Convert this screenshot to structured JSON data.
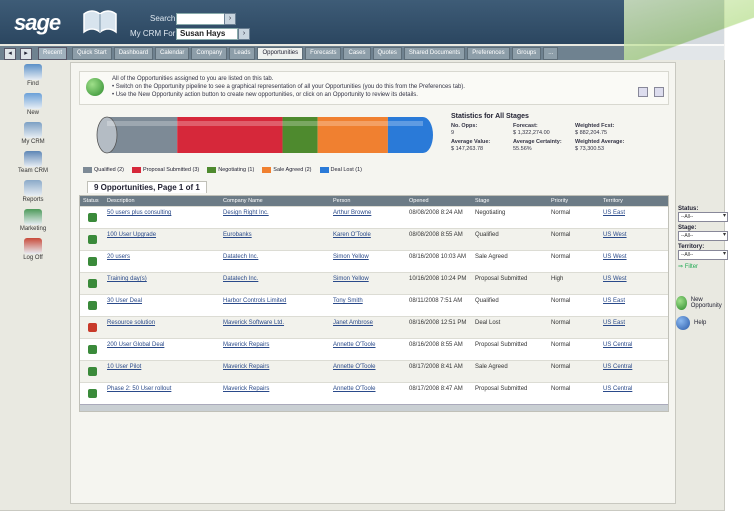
{
  "header": {
    "logo": "sage",
    "search_label": "Search",
    "search_value": "",
    "myrole_label": "My CRM For",
    "user": "Susan Hays"
  },
  "nav": {
    "prev": "◂",
    "next": "▸",
    "recent": "Recent",
    "tabs": [
      "Quick Start",
      "Dashboard",
      "Calendar",
      "Company",
      "Leads",
      "Opportunities",
      "Forecasts",
      "Cases",
      "Quotes",
      "Shared Documents",
      "Preferences",
      "Groups",
      "..."
    ],
    "active_tab": 5
  },
  "sidebar": [
    {
      "label": "Find",
      "color": "#5a8fc7"
    },
    {
      "label": "New",
      "color": "#6aa0d8"
    },
    {
      "label": "My CRM",
      "color": "#7b9fc4"
    },
    {
      "label": "Team CRM",
      "color": "#5d86b5"
    },
    {
      "label": "Reports",
      "color": "#8aa9c8"
    },
    {
      "label": "Marketing",
      "color": "#4d9a5a"
    },
    {
      "label": "Log Off",
      "color": "#c84a3a"
    }
  ],
  "info": {
    "lines": [
      "All of the Opportunities assigned to you are listed on this tab.",
      "•  Switch on the Opportunity pipeline to see a graphical representation of all your Opportunities (you do this from the Preferences tab).",
      "•  Use the New Opportunity action button to create new opportunities, or click on an Opportunity to review its details."
    ]
  },
  "pipeline": {
    "segments": [
      {
        "name": "Qualified (2)",
        "color": "#7d8a96",
        "value": 2
      },
      {
        "name": "Proposal Submitted (3)",
        "color": "#d6283a",
        "value": 3
      },
      {
        "name": "Negotiating (1)",
        "color": "#4e8a2e",
        "value": 1
      },
      {
        "name": "Sale Agreed (2)",
        "color": "#f08030",
        "value": 2
      },
      {
        "name": "Deal Lost (1)",
        "color": "#2a7ad8",
        "value": 1
      }
    ]
  },
  "stats": {
    "title": "Statistics for All Stages",
    "cells": [
      {
        "label": "No. Opps:",
        "value": "9"
      },
      {
        "label": "Forecast:",
        "value": "$ 1,322,274.00"
      },
      {
        "label": "Weighted Fcst:",
        "value": "$ 882,204.75"
      },
      {
        "label": "Average Value:",
        "value": "$ 147,263.78"
      },
      {
        "label": "Average Certainty:",
        "value": "55.56%"
      },
      {
        "label": "Weighted Average:",
        "value": "$ 73,300.53"
      }
    ]
  },
  "list": {
    "title": "9 Opportunities, Page 1 of 1",
    "headers": [
      "Status",
      "Description",
      "Company Name",
      "Person",
      "Opened",
      "Stage",
      "Priority",
      "Territory"
    ],
    "rows": [
      {
        "icon": "#3a8a3a",
        "desc": "50 users plus consulting",
        "company": "Design Right Inc.",
        "person": "Arthur Browne",
        "opened": "08/08/2008 8:24 AM",
        "stage": "Negotiating",
        "priority": "Normal",
        "territory": "US East"
      },
      {
        "icon": "#3a8a3a",
        "desc": "100 User Upgrade",
        "company": "Eurobanks",
        "person": "Karen O'Toole",
        "opened": "08/08/2008 8:55 AM",
        "stage": "Qualified",
        "priority": "Normal",
        "territory": "US West"
      },
      {
        "icon": "#3a8a3a",
        "desc": "20 users",
        "company": "Datatech Inc.",
        "person": "Simon Yellow",
        "opened": "08/16/2008 10:03 AM",
        "stage": "Sale Agreed",
        "priority": "Normal",
        "territory": "US West"
      },
      {
        "icon": "#3a8a3a",
        "desc": "Training day(s)",
        "company": "Datatech Inc.",
        "person": "Simon Yellow",
        "opened": "10/16/2008 10:24 PM",
        "stage": "Proposal Submitted",
        "priority": "High",
        "territory": "US West"
      },
      {
        "icon": "#3a8a3a",
        "desc": "30 User Deal",
        "company": "Harbor Controls Limited",
        "person": "Tony Smith",
        "opened": "08/11/2008 7:51 AM",
        "stage": "Qualified",
        "priority": "Normal",
        "territory": "US East"
      },
      {
        "icon": "#c83a2a",
        "desc": "Resource solution",
        "company": "Maverick Software Ltd.",
        "person": "Janet Ambrose",
        "opened": "08/16/2008 12:51 PM",
        "stage": "Deal Lost",
        "priority": "Normal",
        "territory": "US East"
      },
      {
        "icon": "#3a8a3a",
        "desc": "200 User Global Deal",
        "company": "Maverick Repairs",
        "person": "Annette O'Toole",
        "opened": "08/16/2008 8:55 AM",
        "stage": "Proposal Submitted",
        "priority": "Normal",
        "territory": "US Central"
      },
      {
        "icon": "#3a8a3a",
        "desc": "10 User Pilot",
        "company": "Maverick Repairs",
        "person": "Annette O'Toole",
        "opened": "08/17/2008 8:41 AM",
        "stage": "Sale Agreed",
        "priority": "Normal",
        "territory": "US Central"
      },
      {
        "icon": "#3a8a3a",
        "desc": "Phase 2: 50 User rollout",
        "company": "Maverick Repairs",
        "person": "Annette O'Toole",
        "opened": "08/17/2008 8:47 AM",
        "stage": "Proposal Submitted",
        "priority": "Normal",
        "territory": "US Central"
      }
    ]
  },
  "filters": {
    "status_label": "Status:",
    "status_value": "--All--",
    "stage_label": "Stage:",
    "stage_value": "--All--",
    "territory_label": "Territory:",
    "territory_value": "--All--",
    "filter_button": "Filter"
  },
  "actions": {
    "new_opportunity": "New Opportunity",
    "help": "Help"
  }
}
